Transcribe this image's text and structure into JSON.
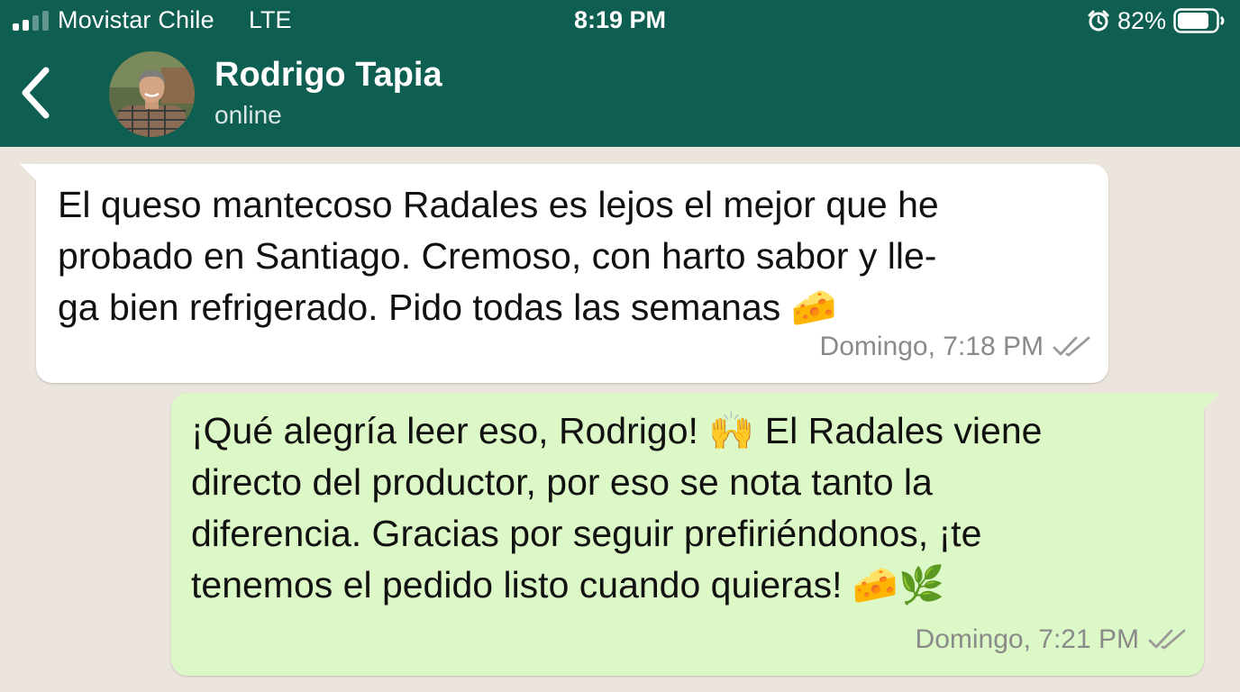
{
  "status_bar": {
    "carrier": "Movistar Chile",
    "network": "LTE",
    "time": "8:19 PM",
    "battery_percent": "82%",
    "signal_bars_filled": 2,
    "signal_bars_total": 4,
    "battery_level": 0.82,
    "icons": [
      "signal-icon",
      "alarm-icon",
      "battery-icon"
    ]
  },
  "chat_header": {
    "contact_name": "Rodrigo Tapia",
    "contact_status": "online",
    "back_icon": "chevron-left-icon",
    "header_color": "#0e5e52"
  },
  "messages": [
    {
      "direction": "incoming",
      "text": "El queso mantecoso Radales es lejos el mejor que he\nprobado en Santiago. Cremoso, con harto sabor y lle-\nga bien refrigerado. Pido todas las semanas 🧀",
      "timestamp": "Domingo, 7:18 PM",
      "status_icon": "double-check-icon",
      "bubble_color": "#ffffff"
    },
    {
      "direction": "outgoing",
      "text": "¡Qué alegría leer eso, Rodrigo! 🙌 El Radales viene\ndirecto del productor, por eso se nota tanto la\ndiferencia. Gracias por seguir prefiriéndonos, ¡te\ntenemos el pedido listo cuando quieras! 🧀🌿",
      "timestamp": "Domingo, 7:21 PM",
      "status_icon": "double-check-icon",
      "bubble_color": "#dcf8c6"
    }
  ],
  "colors": {
    "chat_background": "#ece5dd",
    "timestamp_text": "#8a8a8a"
  }
}
